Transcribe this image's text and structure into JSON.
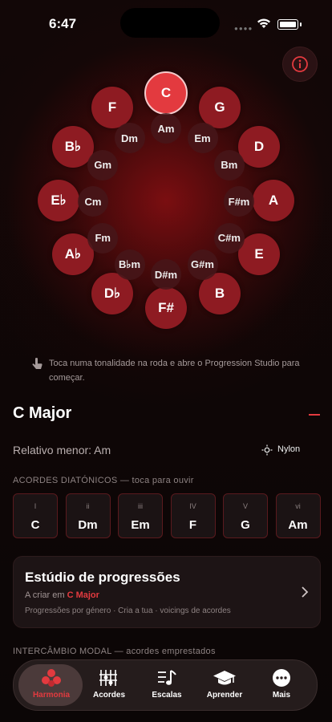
{
  "status": {
    "time": "6:47"
  },
  "wheel": {
    "major": [
      {
        "label": "C",
        "selected": true
      },
      {
        "label": "G"
      },
      {
        "label": "D"
      },
      {
        "label": "A"
      },
      {
        "label": "E"
      },
      {
        "label": "B"
      },
      {
        "label": "F#"
      },
      {
        "label": "D♭"
      },
      {
        "label": "A♭"
      },
      {
        "label": "E♭"
      },
      {
        "label": "B♭"
      },
      {
        "label": "F"
      }
    ],
    "minor": [
      "Am",
      "Em",
      "Bm",
      "F#m",
      "C#m",
      "G#m",
      "D#m",
      "B♭m",
      "Fm",
      "Cm",
      "Gm",
      "Dm"
    ]
  },
  "hint": "Toca numa tonalidade na roda e abre o Progression Studio para começar.",
  "key": {
    "title": "C Major",
    "relative": "Relativo menor: Am",
    "instrument": "Nylon"
  },
  "diatonic": {
    "label": "ACORDES DIATÓNICOS — toca para ouvir",
    "chords": [
      {
        "degree": "I",
        "name": "C"
      },
      {
        "degree": "ii",
        "name": "Dm"
      },
      {
        "degree": "iii",
        "name": "Em"
      },
      {
        "degree": "IV",
        "name": "F"
      },
      {
        "degree": "V",
        "name": "G"
      },
      {
        "degree": "vi",
        "name": "Am"
      }
    ]
  },
  "studio": {
    "title": "Estúdio de progressões",
    "creating_prefix": "A criar em",
    "creating_key": "C Major",
    "description": "Progressões por género · Cria a tua · voicings de acordes"
  },
  "modal": {
    "label": "INTERCÂMBIO MODAL — acordes emprestados"
  },
  "tabs": [
    {
      "label": "Harmonia",
      "icon": "harmony-icon",
      "active": true
    },
    {
      "label": "Acordes",
      "icon": "guitar-chord-icon"
    },
    {
      "label": "Escalas",
      "icon": "music-note-icon"
    },
    {
      "label": "Aprender",
      "icon": "graduation-cap-icon"
    },
    {
      "label": "Mais",
      "icon": "more-icon"
    }
  ],
  "colors": {
    "accent": "#e33a3f",
    "major_bg": "#8e1b22",
    "background": "#0b0606"
  }
}
